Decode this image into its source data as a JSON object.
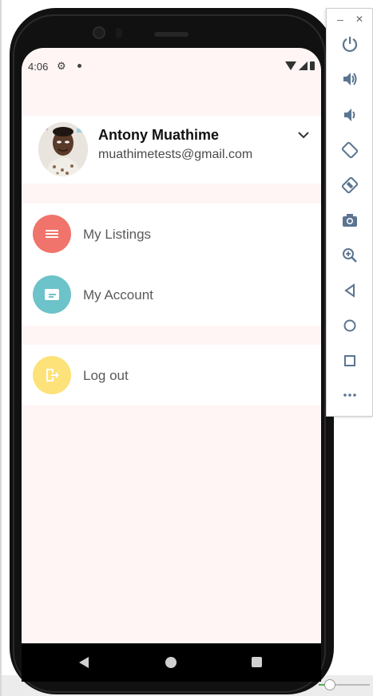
{
  "status_bar": {
    "time": "4:06",
    "icons": [
      "gear-icon",
      "dot-icon",
      "wifi-icon",
      "signal-icon",
      "battery-icon"
    ]
  },
  "profile": {
    "name": "Antony Muathime",
    "email": "muathimetests@gmail.com"
  },
  "menu": {
    "items": [
      {
        "label": "My Listings",
        "icon": "list-icon",
        "color": "#f0746b"
      },
      {
        "label": "My Account",
        "icon": "account-card-icon",
        "color": "#6cc3c9"
      },
      {
        "label": "Log out",
        "icon": "logout-icon",
        "color": "#fde27a"
      }
    ]
  },
  "nav": {
    "buttons": [
      "back",
      "home",
      "recents"
    ]
  },
  "emulator": {
    "buttons": [
      "power",
      "volume-up",
      "volume-down",
      "rotate-left",
      "rotate-right",
      "screenshot",
      "zoom",
      "back",
      "home",
      "overview",
      "more"
    ]
  },
  "colors": {
    "screen_bg": "#fff5f5",
    "card_bg": "#ffffff",
    "name": "#111111",
    "label": "#5a5a5a",
    "panel_icon": "#5b7590"
  }
}
